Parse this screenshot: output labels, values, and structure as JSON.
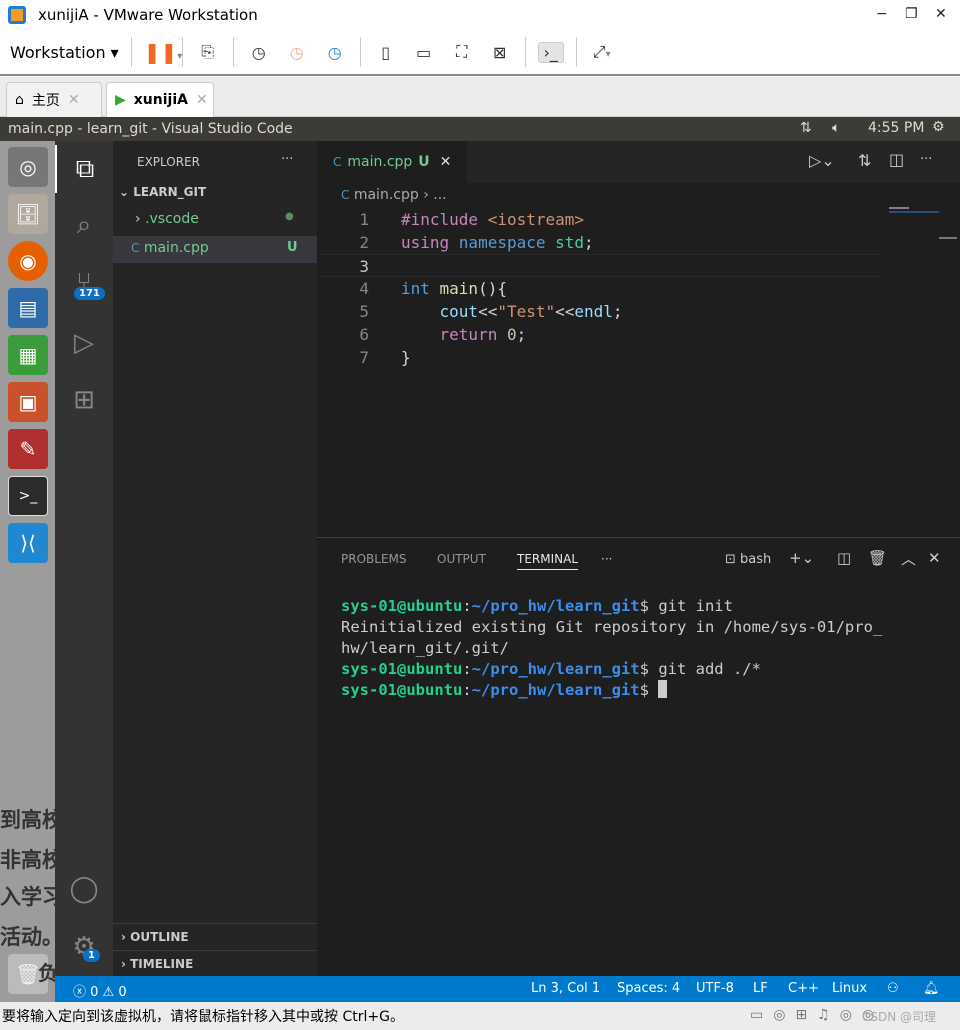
{
  "window": {
    "title": "xunijiA - VMware Workstation",
    "minimize": "−",
    "restore": "❐",
    "close": "✕"
  },
  "toolbar": {
    "workstation": "Workstation"
  },
  "vm_tabs": [
    {
      "label": "主页"
    },
    {
      "label": "xunijiA"
    }
  ],
  "ubuntu_bar": {
    "title": "main.cpp - learn_git - Visual Studio Code",
    "time": "4:55 PM"
  },
  "desktop_bg_text": [
    "到高校",
    "非高校",
    "入学习",
    "活动。",
    "负"
  ],
  "activity": {
    "scm_badge": "171",
    "settings_badge": "1"
  },
  "sidebar": {
    "header": "EXPLORER",
    "more": "···",
    "folder": "LEARN_GIT",
    "items": [
      {
        "name": ".vscode",
        "status": "●"
      },
      {
        "name": "main.cpp",
        "status": "U"
      }
    ],
    "outline": "OUTLINE",
    "timeline": "TIMELINE"
  },
  "editor": {
    "tab": {
      "name": "main.cpp",
      "status": "U"
    },
    "breadcrumb": [
      "main.cpp",
      "..."
    ],
    "lines": [
      [
        [
          "#include ",
          "#c586c0"
        ],
        [
          "<iostream>",
          "#ce9178"
        ]
      ],
      [
        [
          "using ",
          "#c586c0"
        ],
        [
          "namespace ",
          "#569cd6"
        ],
        [
          "std",
          "#4ec9b0"
        ],
        [
          ";",
          "#d4d4d4"
        ]
      ],
      [],
      [
        [
          "int ",
          "#569cd6"
        ],
        [
          "main",
          "#dcdcaa"
        ],
        [
          "(){",
          "#d4d4d4"
        ]
      ],
      [
        [
          "    cout",
          "#9cdcfe"
        ],
        [
          "<<",
          "#d4d4d4"
        ],
        [
          "\"Test\"",
          "#ce9178"
        ],
        [
          "<<",
          "#d4d4d4"
        ],
        [
          "endl",
          "#9cdcfe"
        ],
        [
          ";",
          "#d4d4d4"
        ]
      ],
      [
        [
          "    return ",
          "#c586c0"
        ],
        [
          "0",
          "#b5cea8"
        ],
        [
          ";",
          "#d4d4d4"
        ]
      ],
      [
        [
          "}",
          "#d4d4d4"
        ]
      ]
    ],
    "current_line": 3
  },
  "panel": {
    "tabs": [
      "PROBLEMS",
      "OUTPUT",
      "TERMINAL"
    ],
    "active": "TERMINAL",
    "more": "···",
    "shell": "bash",
    "terminal": [
      {
        "user": "sys-01@ubuntu",
        "path": "~/pro_hw/learn_git",
        "cmd": "git init"
      },
      {
        "out": "Reinitialized existing Git repository in /home/sys-01/pro_"
      },
      {
        "out": "hw/learn_git/.git/"
      },
      {
        "user": "sys-01@ubuntu",
        "path": "~/pro_hw/learn_git",
        "cmd": "git add ./*"
      },
      {
        "user": "sys-01@ubuntu",
        "path": "~/pro_hw/learn_git",
        "cmd": "",
        "cursor": true
      }
    ]
  },
  "status": {
    "errors": "0",
    "warnings": "0",
    "position": "Ln 3, Col 1",
    "spaces": "Spaces: 4",
    "encoding": "UTF-8",
    "eol": "LF",
    "language": "C++",
    "platform": "Linux"
  },
  "vm_status": {
    "hint": "要将输入定向到该虚拟机，请将鼠标指针移入其中或按 Ctrl+G。",
    "watermark": "CSDN @司理"
  },
  "colors": {
    "accent": "#007acc",
    "git_untracked": "#73c991",
    "terminal_user": "#23d18b",
    "terminal_path": "#3b8eea"
  }
}
